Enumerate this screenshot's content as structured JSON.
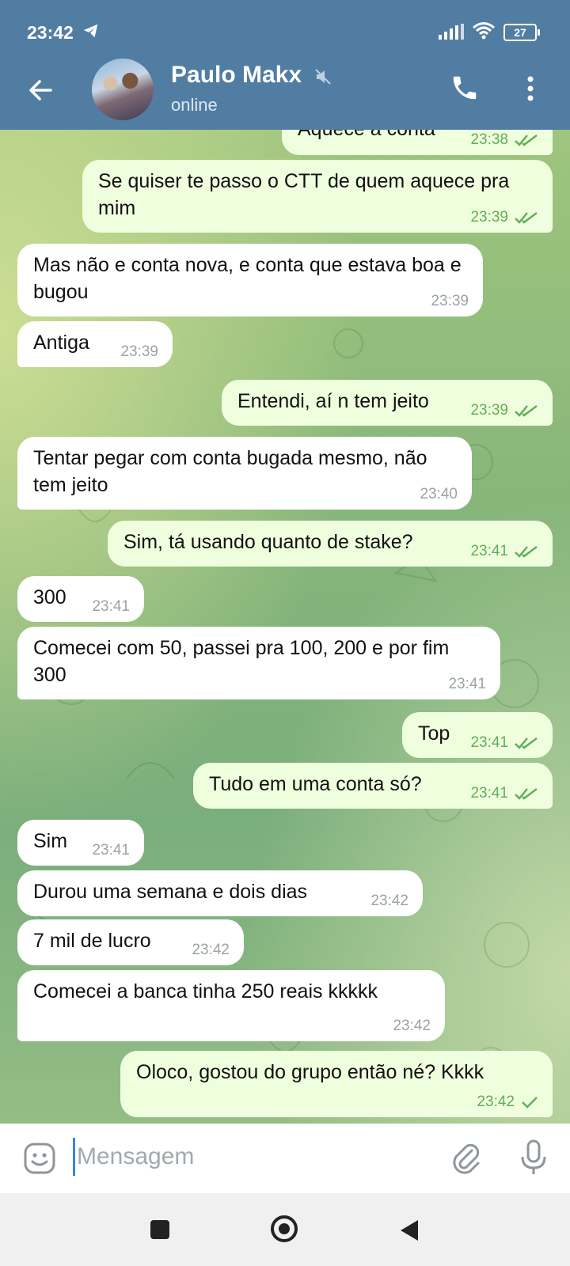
{
  "status_bar": {
    "time": "23:42",
    "battery": "27"
  },
  "header": {
    "contact_name": "Paulo Makx",
    "contact_status": "online"
  },
  "messages": [
    {
      "dir": "out",
      "text": "Aquece a conta",
      "time": "23:38",
      "ticks": "double"
    },
    {
      "dir": "out",
      "text": "Se quiser te passo o CTT de quem aquece pra mim",
      "time": "23:39",
      "ticks": "double"
    },
    {
      "dir": "in",
      "text": "Mas não e conta nova, e conta que estava boa e bugou",
      "time": "23:39"
    },
    {
      "dir": "in",
      "text": "Antiga",
      "time": "23:39"
    },
    {
      "dir": "out",
      "text": "Entendi, aí n tem jeito",
      "time": "23:39",
      "ticks": "double"
    },
    {
      "dir": "in",
      "text": "Tentar pegar com conta bugada mesmo, não tem jeito",
      "time": "23:40"
    },
    {
      "dir": "out",
      "text": "Sim, tá usando quanto de stake?",
      "time": "23:41",
      "ticks": "double"
    },
    {
      "dir": "in",
      "text": "300",
      "time": "23:41"
    },
    {
      "dir": "in",
      "text": "Comecei com 50, passei pra 100, 200 e por fim 300",
      "time": "23:41"
    },
    {
      "dir": "out",
      "text": "Top",
      "time": "23:41",
      "ticks": "double"
    },
    {
      "dir": "out",
      "text": "Tudo em uma conta só?",
      "time": "23:41",
      "ticks": "double"
    },
    {
      "dir": "in",
      "text": "Sim",
      "time": "23:41"
    },
    {
      "dir": "in",
      "text": "Durou uma semana e dois dias",
      "time": "23:42"
    },
    {
      "dir": "in",
      "text": "7 mil de lucro",
      "time": "23:42"
    },
    {
      "dir": "in",
      "text": "Comecei a banca tinha 250 reais kkkkk",
      "time": "23:42"
    },
    {
      "dir": "out",
      "text": "Oloco, gostou do grupo então né? Kkkk",
      "time": "23:42",
      "ticks": "single"
    }
  ],
  "composer": {
    "placeholder": "Mensagem"
  },
  "colors": {
    "header": "#527da3",
    "outgoing_bubble": "#efffde",
    "incoming_bubble": "#ffffff",
    "tick": "#5fae57"
  },
  "icons": [
    "telegram-icon",
    "signal-icon",
    "wifi-icon",
    "back-arrow-icon",
    "mute-icon",
    "phone-icon",
    "more-vert-icon",
    "emoji-icon",
    "attach-icon",
    "mic-icon",
    "nav-square-icon",
    "nav-home-icon",
    "nav-back-icon"
  ]
}
